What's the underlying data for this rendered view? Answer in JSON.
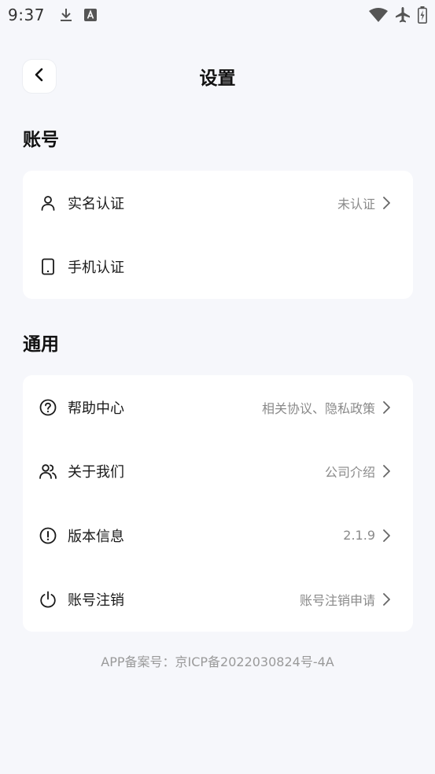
{
  "status_bar": {
    "time": "9:37",
    "left_icons": [
      "download-icon",
      "font-a-icon"
    ],
    "right_icons": [
      "wifi-icon",
      "airplane-icon",
      "battery-icon"
    ]
  },
  "header": {
    "title": "设置",
    "back_icon": "chevron-left-icon"
  },
  "sections": {
    "account": {
      "title": "账号",
      "items": [
        {
          "label": "实名认证",
          "value": "未认证",
          "icon": "user-icon",
          "has_chevron": true
        },
        {
          "label": "手机认证",
          "value": "",
          "icon": "phone-icon",
          "has_chevron": false
        }
      ]
    },
    "general": {
      "title": "通用",
      "items": [
        {
          "label": "帮助中心",
          "value": "相关协议、隐私政策",
          "icon": "help-circle-icon",
          "has_chevron": true
        },
        {
          "label": "关于我们",
          "value": "公司介绍",
          "icon": "users-icon",
          "has_chevron": true
        },
        {
          "label": "版本信息",
          "value": "2.1.9",
          "icon": "alert-circle-icon",
          "has_chevron": true
        },
        {
          "label": "账号注销",
          "value": "账号注销申请",
          "icon": "power-icon",
          "has_chevron": true
        }
      ]
    }
  },
  "footer": {
    "icp": "APP备案号：京ICP备2022030824号-4A"
  },
  "colors": {
    "background": "#f6f7fb",
    "card": "#ffffff",
    "primary_text": "#1a1a1a",
    "secondary_text": "#8a8a8a"
  }
}
